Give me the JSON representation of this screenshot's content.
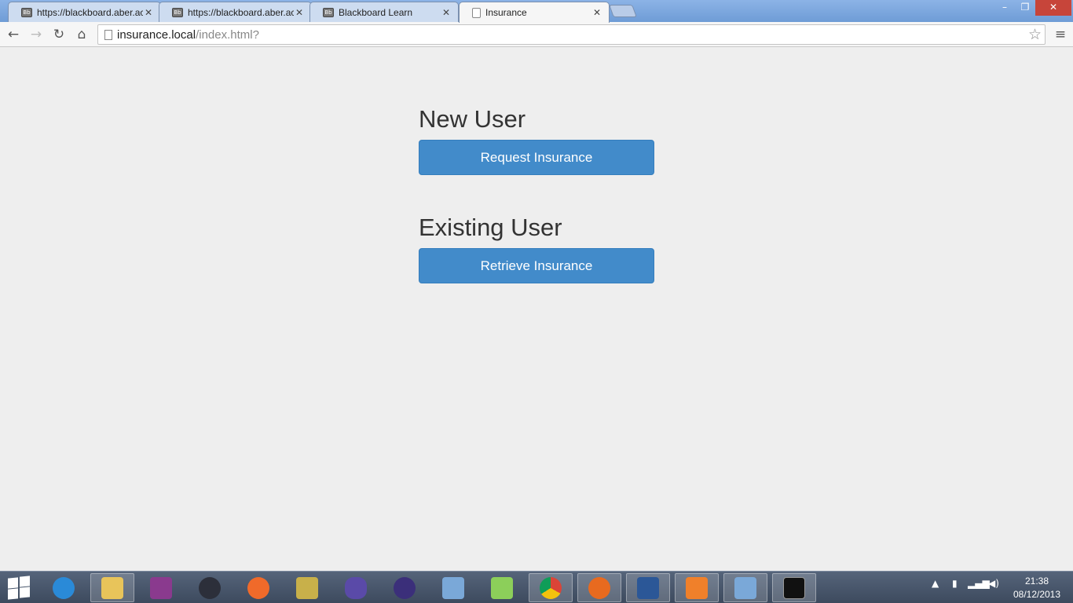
{
  "browser": {
    "tabs": [
      {
        "title": "https://blackboard.aber.ac",
        "favicon": "blackboard-icon",
        "active": false
      },
      {
        "title": "https://blackboard.aber.ac",
        "favicon": "blackboard-icon",
        "active": false
      },
      {
        "title": "Blackboard Learn",
        "favicon": "blackboard-icon",
        "active": false
      },
      {
        "title": "Insurance",
        "favicon": "page-icon",
        "active": true
      }
    ],
    "favicon_text": "Bb",
    "tab_close_glyph": "✕",
    "url_host": "insurance.local",
    "url_path": "/index.html?",
    "window_controls": {
      "minimize": "–",
      "restore": "❐",
      "close": "✕"
    }
  },
  "page": {
    "new_user_heading": "New User",
    "request_button": "Request Insurance",
    "existing_user_heading": "Existing User",
    "retrieve_button": "Retrieve Insurance"
  },
  "taskbar": {
    "apps": [
      "start-icon",
      "internet-explorer-icon",
      "file-explorer-icon",
      "onenote-icon",
      "steam-icon",
      "origin-icon",
      "tools-icon",
      "visual-studio-icon",
      "eclipse-icon",
      "virtualbox-icon",
      "notepad-plus-plus-icon",
      "chrome-icon",
      "firefox-icon",
      "word-icon",
      "xampp-icon",
      "virtualbox-icon",
      "command-prompt-icon"
    ],
    "clock_time": "21:38",
    "clock_date": "08/12/2013"
  },
  "colors": {
    "primary_button": "#428bca",
    "page_background": "#eeeeee"
  }
}
